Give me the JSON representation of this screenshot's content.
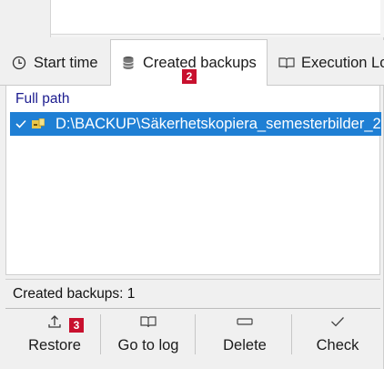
{
  "tabs": [
    {
      "label": "Start time",
      "icon": "clock-icon"
    },
    {
      "label": "Created backups",
      "icon": "database-icon"
    },
    {
      "label": "Execution Lo",
      "icon": "book-icon"
    }
  ],
  "list": {
    "column_header": "Full path",
    "rows": [
      {
        "path": "D:\\BACKUP\\Säkerhetskopiera_semesterbilder_2",
        "selected": true
      }
    ]
  },
  "status": {
    "text": "Created backups: 1"
  },
  "toolbar": {
    "buttons": [
      {
        "label": "Restore",
        "icon": "upload-icon"
      },
      {
        "label": "Go to log",
        "icon": "book-icon"
      },
      {
        "label": "Delete",
        "icon": "dash-icon"
      },
      {
        "label": "Check",
        "icon": "checkmark-icon"
      }
    ]
  },
  "annotations": {
    "badge_tab": "2",
    "badge_restore": "3",
    "badge_color": "#c8102e"
  },
  "colors": {
    "selection": "#1f7fd4",
    "header_text": "#1c1c8f"
  }
}
